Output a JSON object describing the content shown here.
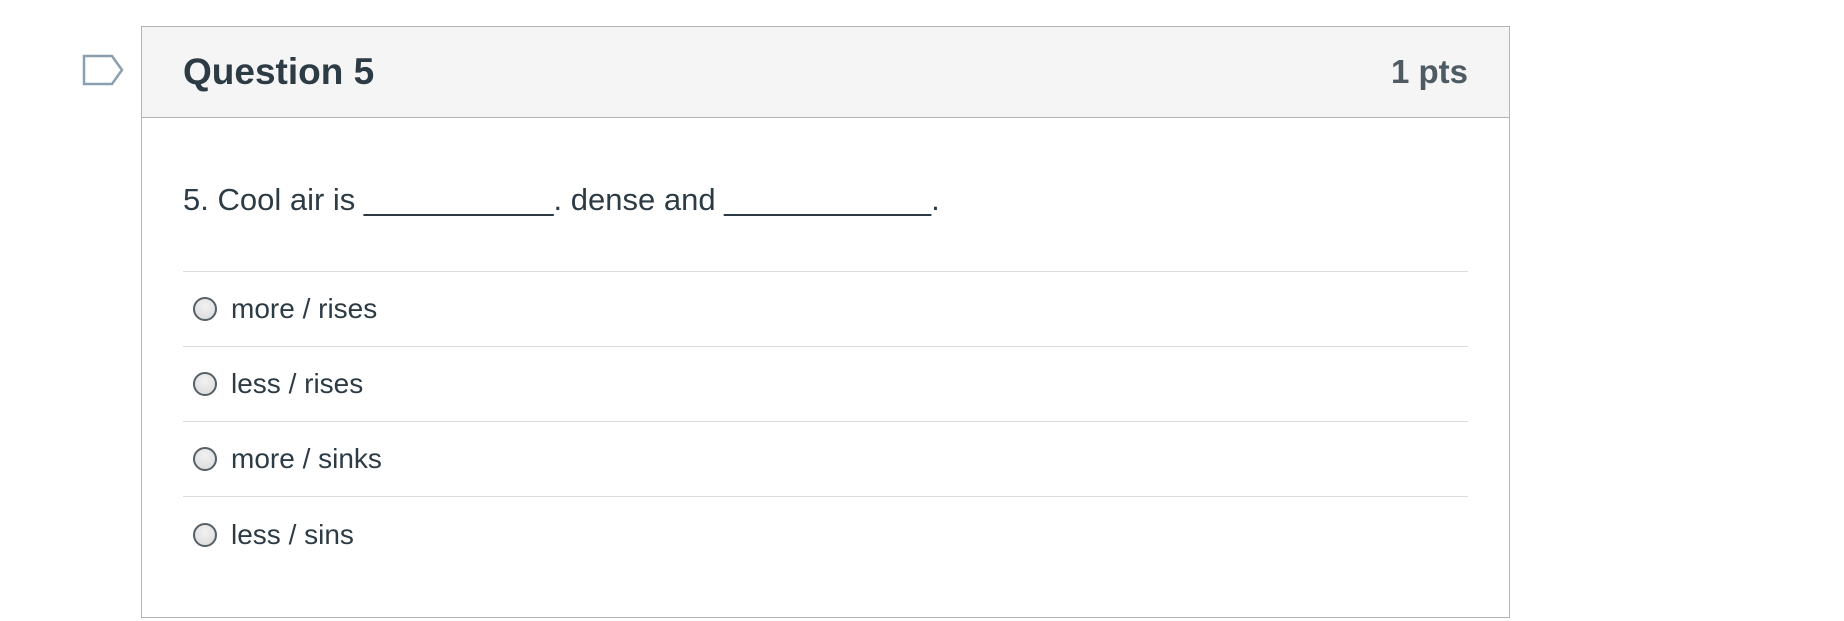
{
  "question": {
    "title": "Question 5",
    "points": "1 pts",
    "text": "5. Cool air is ___________. dense and ____________.",
    "flagged": false
  },
  "answers": [
    {
      "label": "more / rises",
      "selected": false
    },
    {
      "label": "less / rises",
      "selected": false
    },
    {
      "label": "more / sinks",
      "selected": false
    },
    {
      "label": "less / sins",
      "selected": false
    }
  ],
  "icons": {
    "flag": "flag-question-icon",
    "radio": "radio-unselected-icon"
  },
  "colors": {
    "text": "#2d3b45",
    "header_bg": "#f5f5f5",
    "border": "#b4b4b4",
    "flag_outline": "#8aa0b0"
  }
}
